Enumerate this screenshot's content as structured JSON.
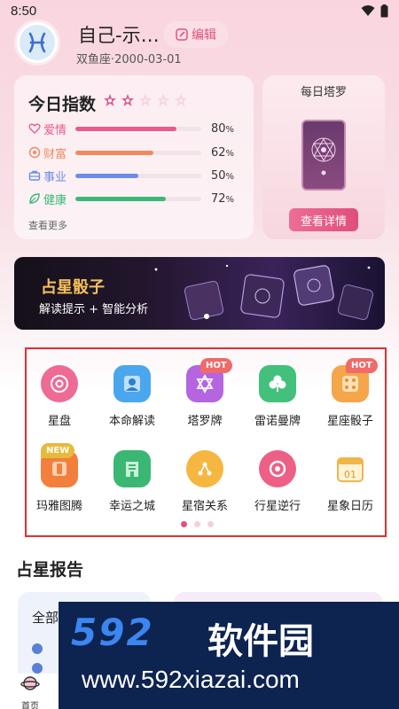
{
  "status": {
    "time": "8:50"
  },
  "profile": {
    "name": "自己-示…",
    "edit_label": "编辑",
    "sign_date": "双鱼座·2000-03-01"
  },
  "index": {
    "title": "今日指数",
    "stars_filled": 2,
    "stars_total": 5,
    "rows": [
      {
        "label": "爱情",
        "value": 80,
        "pct": "80",
        "color": "#ea5a8a",
        "icon": "heart-icon"
      },
      {
        "label": "财富",
        "value": 62,
        "pct": "62",
        "color": "#f08a5d",
        "icon": "coin-icon"
      },
      {
        "label": "事业",
        "value": 50,
        "pct": "50",
        "color": "#6b8ce8",
        "icon": "briefcase-icon"
      },
      {
        "label": "健康",
        "value": 72,
        "pct": "72",
        "color": "#3cb878",
        "icon": "leaf-icon"
      }
    ],
    "percent_sign": "%",
    "more_label": "查看更多"
  },
  "tarot": {
    "title": "每日塔罗",
    "button_label": "查看详情"
  },
  "banner": {
    "title": "占星骰子",
    "subtitle": "解读提示 + 智能分析"
  },
  "features": [
    {
      "label": "星盘",
      "icon": "astrolabe-icon",
      "tag": "",
      "color": "#ee6b93"
    },
    {
      "label": "本命解读",
      "icon": "portrait-icon",
      "tag": "",
      "color": "#4aa7ee"
    },
    {
      "label": "塔罗牌",
      "icon": "tarot-star-icon",
      "tag": "HOT",
      "color": "#b565e0"
    },
    {
      "label": "雷诺曼牌",
      "icon": "clover-icon",
      "tag": "",
      "color": "#43c07b"
    },
    {
      "label": "星座骰子",
      "icon": "dice-icon",
      "tag": "HOT",
      "color": "#f5a54a"
    },
    {
      "label": "玛雅图腾",
      "icon": "totem-icon",
      "tag": "NEW",
      "color": "#f27f3c"
    },
    {
      "label": "幸运之城",
      "icon": "city-icon",
      "tag": "",
      "color": "#3bb774"
    },
    {
      "label": "星宿关系",
      "icon": "relation-icon",
      "tag": "",
      "color": "#f5b740"
    },
    {
      "label": "行星逆行",
      "icon": "planet-icon",
      "tag": "",
      "color": "#ee5f86"
    },
    {
      "label": "星象日历",
      "icon": "calendar-icon",
      "tag": "",
      "color": "#f2b54a"
    }
  ],
  "report": {
    "title": "占星报告",
    "card_title": "全部"
  },
  "watermark": {
    "digits": "592",
    "cn": "软件园",
    "url": "www.592xiazai.com"
  },
  "tabbar": {
    "home_label": "首页"
  }
}
